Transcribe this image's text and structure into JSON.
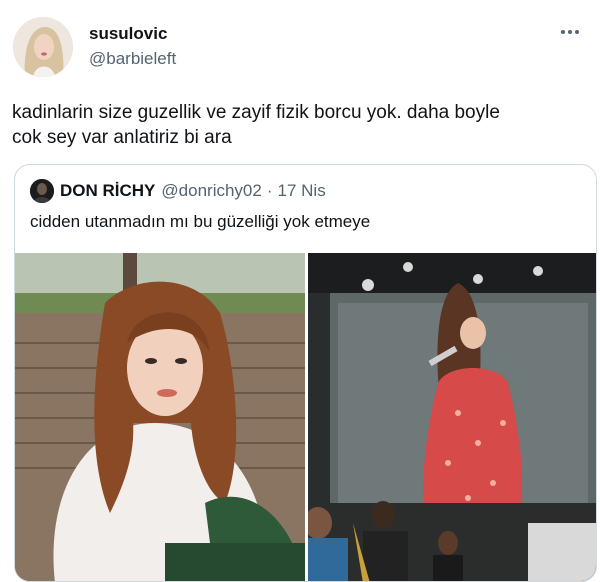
{
  "tweet": {
    "display_name": "susulovic",
    "handle": "@barbieleft",
    "text_lines": [
      "kadinlarin size guzellik ve zayif fizik borcu yok. daha boyle",
      "cok sey var anlatiriz bi ara"
    ]
  },
  "quoted_tweet": {
    "display_name": "DON RİCHY",
    "handle": "@donrichy02",
    "separator": "·",
    "date": "17 Nis",
    "text": "cidden utanmadın mı bu güzelliği yok etmeye"
  },
  "icons": {
    "more": "more-horizontal-icon"
  },
  "colors": {
    "text_primary": "#0f1419",
    "text_secondary": "#536471",
    "border": "#cfd9de"
  }
}
